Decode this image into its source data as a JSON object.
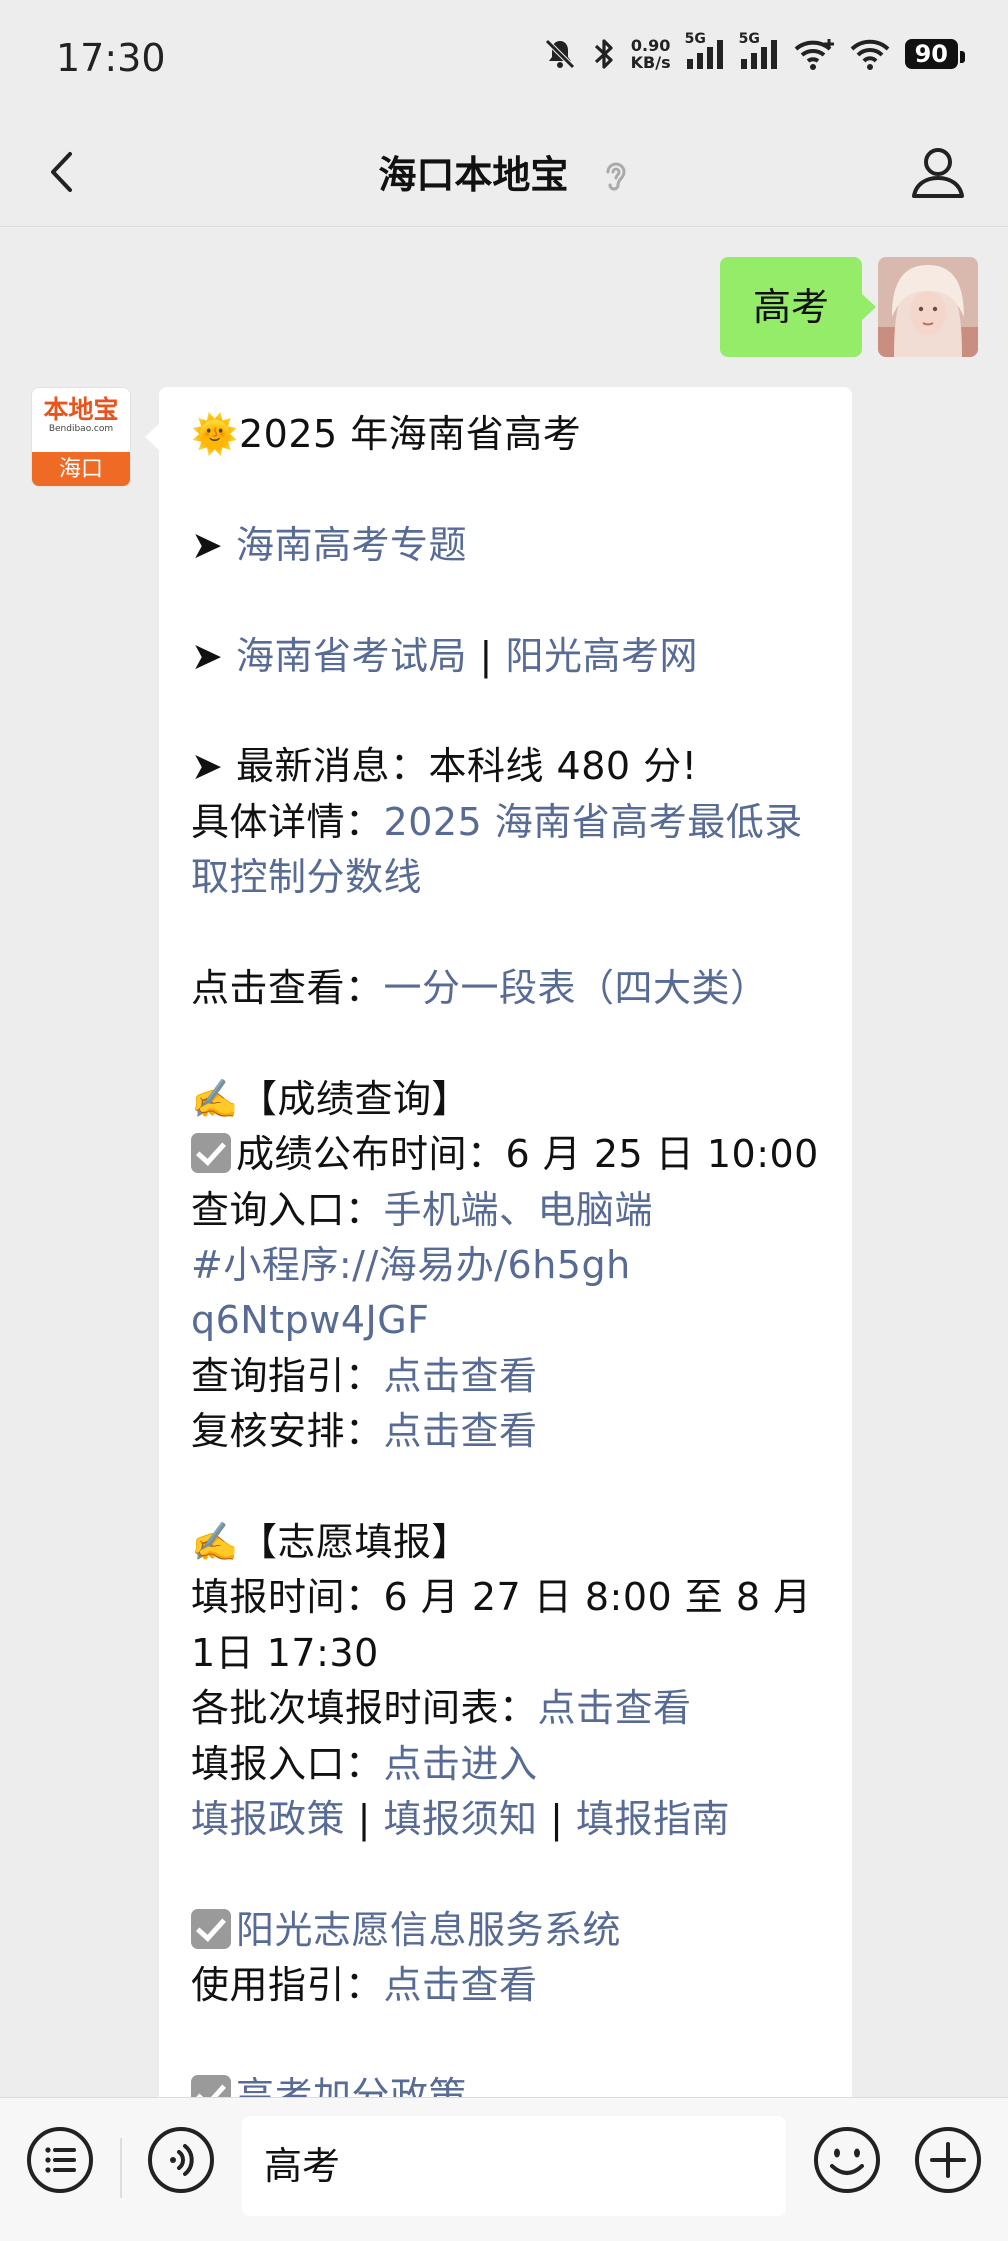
{
  "status_bar": {
    "time": "17:30",
    "net_speed_value": "0.90",
    "net_speed_unit": "KB/s",
    "signal_1_label": "5G",
    "signal_2_label": "5G",
    "battery": "90"
  },
  "header": {
    "title": "海口本地宝"
  },
  "outgoing_message": {
    "text": "高考"
  },
  "bot_avatar": {
    "logo_text": "本地宝",
    "logo_subtext": "Bendibao.com",
    "city": "海口"
  },
  "reply": {
    "title_emoji": "🌞",
    "title": "2025 年海南省高考",
    "arrow": "➤",
    "link_topic": "海南高考专题",
    "link_exam_bureau": "海南省考试局",
    "separator": "|",
    "link_sunshine": "阳光高考网",
    "latest_news": "最新消息：本科线 480 分!",
    "detail_label": "具体详情：",
    "detail_link": "2025 海南省高考最低录取控制分数线",
    "view_label": "点击查看：",
    "view_link": "一分一段表（四大类）",
    "write_emoji": "✍️",
    "section_scores": "【成绩查询】",
    "score_release": "成绩公布时间：6 月 25 日 10:00",
    "query_entry_label": "查询入口：",
    "query_entry_links": "手机端、电脑端",
    "miniprogram_link": "#小程序://海易办/6h5ghq6Ntpw4JGF",
    "query_guide_label": "查询指引：",
    "review_label": "复核安排：",
    "click_view": "点击查看",
    "section_volunteer": "【志愿填报】",
    "fill_time": "填报时间：6 月 27 日 8:00 至 8 月 1日 17:30",
    "batch_schedule_label": "各批次填报时间表：",
    "fill_entry_label": "填报入口：",
    "click_enter": "点击进入",
    "fill_policy": "填报政策",
    "fill_notice": "填报须知",
    "fill_guide": "填报指南",
    "sunshine_system_link": "阳光志愿信息服务系统",
    "usage_guide_label": "使用指引：",
    "bonus_policy_link": "高考加分政策"
  },
  "input_bar": {
    "text": "高考"
  }
}
